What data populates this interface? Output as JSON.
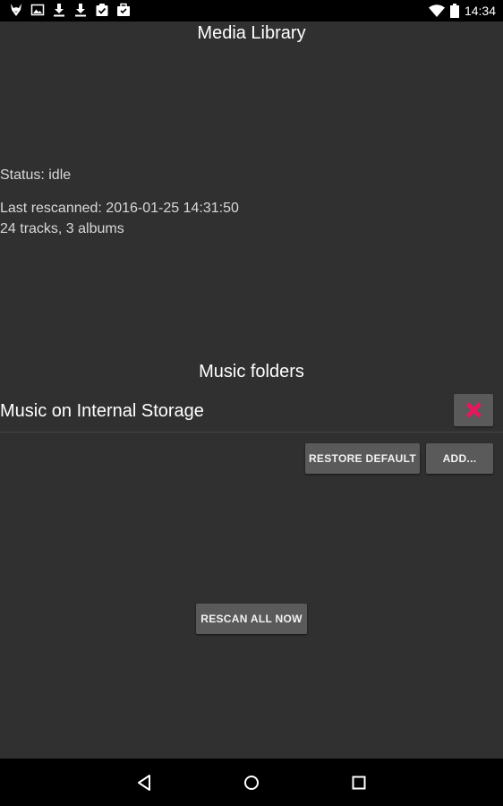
{
  "status_bar": {
    "time": "14:34",
    "notification_icons": [
      "fox-icon",
      "image-icon",
      "download-icon",
      "download-icon",
      "clipboard-check-icon",
      "briefcase-icon"
    ],
    "system_icons": [
      "wifi-icon",
      "battery-icon"
    ]
  },
  "header": {
    "title": "Media Library"
  },
  "library": {
    "status": "Status: idle",
    "last_rescanned": "Last rescanned: 2016-01-25 14:31:50",
    "counts": "24 tracks, 3 albums"
  },
  "folders": {
    "section_title": "Music folders",
    "items": [
      {
        "name": "Music on Internal Storage"
      }
    ],
    "restore_default_label": "RESTORE DEFAULT",
    "add_label": "ADD..."
  },
  "rescan": {
    "label": "RESCAN ALL NOW"
  },
  "colors": {
    "background": "#303030",
    "button": "#5a5a5a",
    "remove_icon": "#e8175d",
    "bars": "#000000"
  }
}
